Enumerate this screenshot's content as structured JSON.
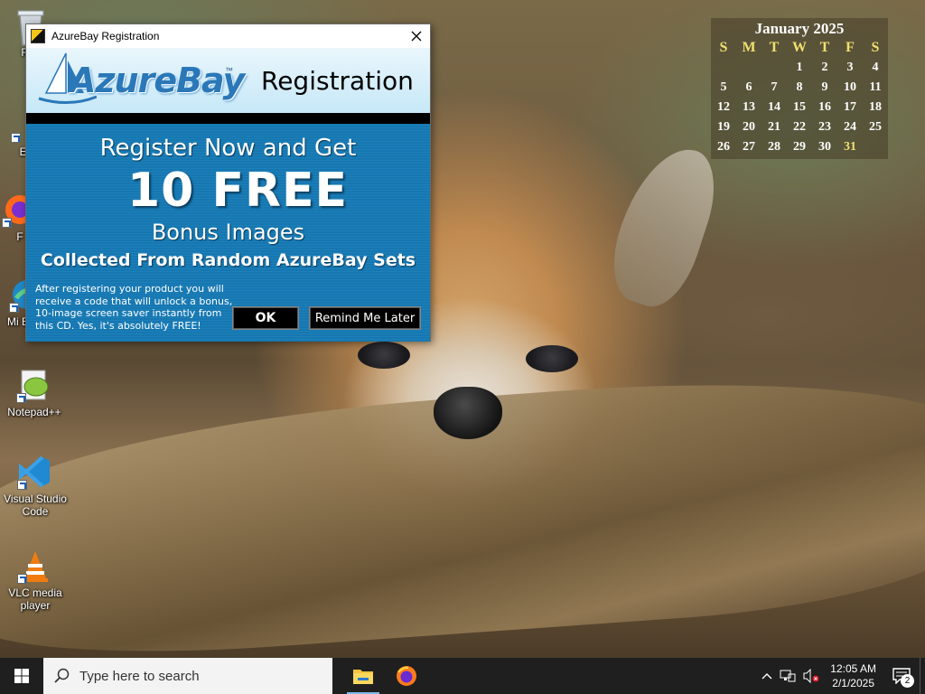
{
  "desktop": {
    "icons": [
      {
        "label": "Recycle Bin",
        "visible_label": "Rec"
      },
      {
        "label": "Everything",
        "visible_label": "Eve"
      },
      {
        "label": "Firefox",
        "visible_label": "F"
      },
      {
        "label": "Microsoft Edge",
        "visible_label": "Mi Edge"
      },
      {
        "label": "Notepad++"
      },
      {
        "label": "Visual Studio Code"
      },
      {
        "label": "VLC media player"
      }
    ]
  },
  "calendar": {
    "title": "January 2025",
    "weekdays": [
      "S",
      "M",
      "T",
      "W",
      "T",
      "F",
      "S"
    ],
    "days": [
      "",
      "",
      "",
      "1",
      "2",
      "3",
      "4",
      "5",
      "6",
      "7",
      "8",
      "9",
      "10",
      "11",
      "12",
      "13",
      "14",
      "15",
      "16",
      "17",
      "18",
      "19",
      "20",
      "21",
      "22",
      "23",
      "24",
      "25",
      "26",
      "27",
      "28",
      "29",
      "30",
      "31",
      ""
    ],
    "today": "31",
    "highlight_color": "#f0e070"
  },
  "dialog": {
    "title": "AzureBay Registration",
    "logo_text": "AzureBay",
    "logo_tm": "™",
    "banner_title": "Registration",
    "promo": {
      "line1": "Register Now and Get",
      "line2": "10 FREE",
      "line3": "Bonus Images",
      "line4": "Collected From Random AzureBay Sets",
      "details": "After registering your product you will receive a code that will unlock a bonus, 10-image screen saver instantly from this CD. Yes, it's absolutely FREE!"
    },
    "buttons": {
      "ok": "OK",
      "remind": "Remind Me Later"
    },
    "colors": {
      "promo_bg": "#1777b0",
      "banner_bg": "#c6e8f7"
    }
  },
  "taskbar": {
    "search_placeholder": "Type here to search",
    "apps": [
      "File Explorer",
      "Firefox"
    ],
    "clock": {
      "time": "12:05 AM",
      "date": "2/1/2025"
    },
    "notification_count": "2"
  }
}
